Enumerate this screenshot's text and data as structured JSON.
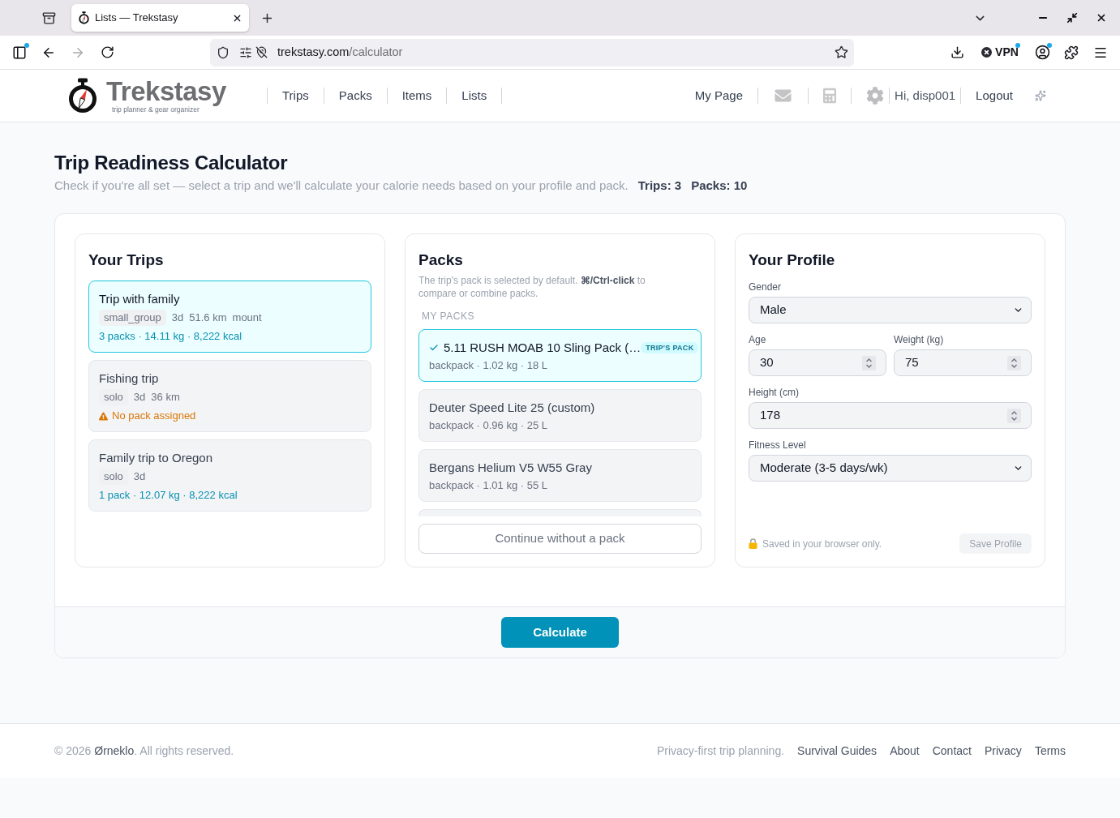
{
  "browser": {
    "tabs": [
      {
        "title": "Lists — Trekstasy",
        "selected": true
      }
    ],
    "forward_disabled": true,
    "address": {
      "host": "trekstasy.com",
      "path": "/calculator"
    },
    "vpn_label": "VPN",
    "notification_dots": {
      "sidebar": true,
      "vpn": true,
      "account": true
    }
  },
  "header": {
    "brand": {
      "name": "Trekstasy",
      "tagline": "trip planner & gear organizer"
    },
    "nav": [
      "Trips",
      "Packs",
      "Items",
      "Lists"
    ],
    "my_page": "My Page",
    "greeting": "Hi, disp001",
    "logout": "Logout"
  },
  "page": {
    "title": "Trip Readiness Calculator",
    "subtitle": "Check if you're all set — select a trip and we'll calculate your calorie needs based on your profile and pack.",
    "stats": [
      "Trips: 3",
      "Packs: 10"
    ]
  },
  "trips": {
    "title": "Your Trips",
    "items": [
      {
        "name": "Trip with family",
        "selected": true,
        "group": "small_group",
        "details": [
          "3d",
          "51.6 km",
          "mount"
        ],
        "summary": {
          "kind": "stats",
          "text": "3 packs · 14.11 kg · 8,222 kcal"
        }
      },
      {
        "name": "Fishing trip",
        "selected": false,
        "group": "solo",
        "details": [
          "3d",
          "36 km"
        ],
        "summary": {
          "kind": "warning",
          "text": "No pack assigned"
        }
      },
      {
        "name": "Family trip to Oregon",
        "selected": false,
        "group": "solo",
        "details": [
          "3d"
        ],
        "summary": {
          "kind": "stats",
          "text": "1 pack · 12.07 kg · 8,222 kcal"
        }
      }
    ]
  },
  "packs": {
    "title": "Packs",
    "hint": "The trip's pack is selected by default. **⌘/Ctrl-click** to compare or combine packs.",
    "section_label": "MY PACKS",
    "items": [
      {
        "name": "5.11 RUSH MOAB 10 Sling Pack (…",
        "meta": "backpack · 1.02 kg · 18 L",
        "selected": true,
        "badge": "TRIP'S PACK"
      },
      {
        "name": "Deuter Speed Lite 25 (custom)",
        "meta": "backpack · 0.96 kg · 25 L",
        "selected": false
      },
      {
        "name": "Bergans Helium V5 W55 Gray",
        "meta": "backpack · 1.01 kg · 55 L",
        "selected": false
      }
    ],
    "more_below": true,
    "continue_button": "Continue without a pack"
  },
  "profile": {
    "title": "Your Profile",
    "rows": [
      {
        "fields": [
          {
            "kind": "select",
            "label": "Gender",
            "value": "Male"
          }
        ]
      },
      {
        "fields": [
          {
            "kind": "number",
            "label": "Age",
            "value": "30"
          },
          {
            "kind": "number",
            "label": "Weight (kg)",
            "value": "75"
          }
        ]
      },
      {
        "fields": [
          {
            "kind": "number",
            "label": "Height (cm)",
            "value": "178"
          }
        ]
      },
      {
        "fields": [
          {
            "kind": "select",
            "label": "Fitness Level",
            "value": "Moderate (3-5 days/wk)"
          }
        ]
      }
    ],
    "note": "Saved in your browser only.",
    "save_button": {
      "label": "Save Profile",
      "disabled": true
    }
  },
  "calculate_button": "Calculate",
  "footer": {
    "copyright": {
      "before": "© 2026 ",
      "brand": "Ørneklo",
      "after": ". All rights reserved."
    },
    "tagline": "Privacy-first trip planning.",
    "links": [
      "Survival Guides",
      "About",
      "Contact",
      "Privacy",
      "Terms"
    ]
  }
}
